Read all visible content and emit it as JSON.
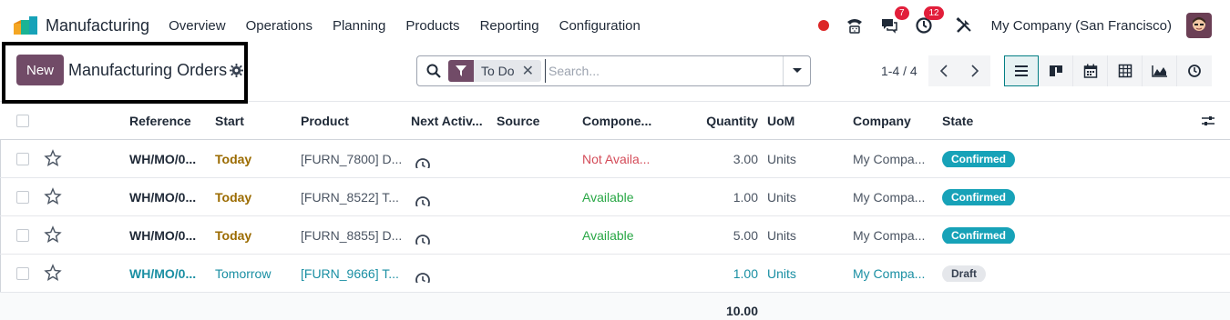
{
  "app": {
    "name": "Manufacturing",
    "menu": [
      "Overview",
      "Operations",
      "Planning",
      "Products",
      "Reporting",
      "Configuration"
    ]
  },
  "systray": {
    "messages_count": "7",
    "activities_count": "12",
    "company": "My Company (San Francisco)"
  },
  "control_panel": {
    "new_label": "New",
    "title": "Manufacturing Orders",
    "facet_label": "To Do",
    "search_placeholder": "Search...",
    "pager": "1-4 / 4"
  },
  "table": {
    "headers": {
      "reference": "Reference",
      "start": "Start",
      "product": "Product",
      "next_activity": "Next Activ...",
      "source": "Source",
      "component": "Compone...",
      "quantity": "Quantity",
      "uom": "UoM",
      "company": "Company",
      "state": "State"
    },
    "rows": [
      {
        "reference": "WH/MO/0...",
        "start": "Today",
        "product": "[FURN_7800] D...",
        "component": "Not Availa...",
        "component_status": "red",
        "quantity": "3.00",
        "uom": "Units",
        "company": "My Compa...",
        "state": "Confirmed"
      },
      {
        "reference": "WH/MO/0...",
        "start": "Today",
        "product": "[FURN_8522] T...",
        "component": "Available",
        "component_status": "green",
        "quantity": "1.00",
        "uom": "Units",
        "company": "My Compa...",
        "state": "Confirmed"
      },
      {
        "reference": "WH/MO/0...",
        "start": "Today",
        "product": "[FURN_8855] D...",
        "component": "Available",
        "component_status": "green",
        "quantity": "5.00",
        "uom": "Units",
        "company": "My Compa...",
        "state": "Confirmed"
      },
      {
        "reference": "WH/MO/0...",
        "start": "Tomorrow",
        "product": "[FURN_9666] T...",
        "component": "",
        "component_status": "",
        "quantity": "1.00",
        "uom": "Units",
        "company": "My Compa...",
        "state": "Draft"
      }
    ],
    "total_quantity": "10.00"
  },
  "colors": {
    "brand": "#714b67",
    "teal": "#017e84",
    "confirmed": "#17a2b8",
    "today": "#9b6b00",
    "not_available": "#d44c59",
    "available": "#28a745"
  }
}
